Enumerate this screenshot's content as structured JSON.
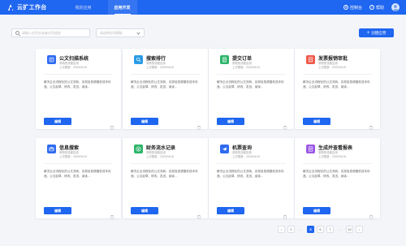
{
  "header": {
    "app_title": "云扩工作台",
    "nav": [
      "我的应用",
      "应用开发"
    ],
    "console_label": "控制台",
    "help_label": "帮助"
  },
  "toolbar": {
    "search_placeholder": "请输入应用名或者应用描述",
    "select_placeholder": "请选择应用模板",
    "create_label": "创建应用"
  },
  "cards": [
    {
      "name": "公文扫描系统",
      "category": "采购的流程应用",
      "updated": "上次更新：2020/04/15",
      "desc": "解决企业流程化的公文流转、实现信息便捷低成本传递、公文起草、修改、发送、阅读...",
      "edit_label": "编辑",
      "icon": "document-icon",
      "color": "#2f6bf2"
    },
    {
      "name": "搜索排行",
      "category": "采购的流程应用",
      "updated": "上次更新：2020/04/15",
      "desc": "解决企业流程化的公文流转、实现信息便捷低成本传递、公文起草、修改、发送、阅读...",
      "edit_label": "编辑",
      "icon": "search-icon",
      "color": "#2b9be5"
    },
    {
      "name": "提交订单",
      "category": "采购的流程应用",
      "updated": "上次更新：2020/04/15",
      "desc": "解决企业流程化的公文流转、实现信息便捷低成本传递、公文起草、修改、发送、阅读...",
      "edit_label": "编辑",
      "icon": "order-icon",
      "color": "#2db46a"
    },
    {
      "name": "发票报销审批",
      "category": "采购的流程应用",
      "updated": "上次更新：2020/04/15",
      "desc": "解决企业流程化的公文流转、实现信息便捷低成本传递、公文起草、修改、发送、阅读...",
      "edit_label": "编辑",
      "icon": "invoice-icon",
      "color": "#ef5a4a"
    },
    {
      "name": "信息搜索",
      "category": "采购的流程应用",
      "updated": "上次更新：2020/04/15",
      "desc": "解决企业流程化的公文流转、实现信息便捷低成本传递、公文起草、修改、发送、阅读...",
      "edit_label": "编辑",
      "icon": "briefcase-icon",
      "color": "#2f6bf2"
    },
    {
      "name": "财务流水记录",
      "category": "采购的流程应用",
      "updated": "上次更新：2020/04/15",
      "desc": "解决企业流程化的公文流转、实现信息便捷低成本传递、公文起草、修改、发送、阅读...",
      "edit_label": "编辑",
      "icon": "yuan-icon",
      "color": "#2db46a"
    },
    {
      "name": "机票查询",
      "category": "采购的流程应用",
      "updated": "上次更新：2020/04/15",
      "desc": "解决企业流程化的公文流转、实现信息便捷低成本传递、公文起草、修改、发送、阅读...",
      "edit_label": "编辑",
      "icon": "plane-icon",
      "color": "#2f6bf2"
    },
    {
      "name": "生成并查看报表",
      "category": "采购的流程应用",
      "updated": "上次更新：2020/04/15",
      "desc": "解决企业流程化的公文流转、实现信息便捷低成本传递、公文起草、修改、发送、阅读...",
      "edit_label": "编辑",
      "icon": "report-icon",
      "color": "#9b58e6"
    }
  ],
  "pagination": {
    "prev": "‹",
    "pages": [
      "1",
      "...",
      "5",
      "6",
      "7",
      "...",
      "10"
    ],
    "current": "5",
    "next": "›"
  }
}
